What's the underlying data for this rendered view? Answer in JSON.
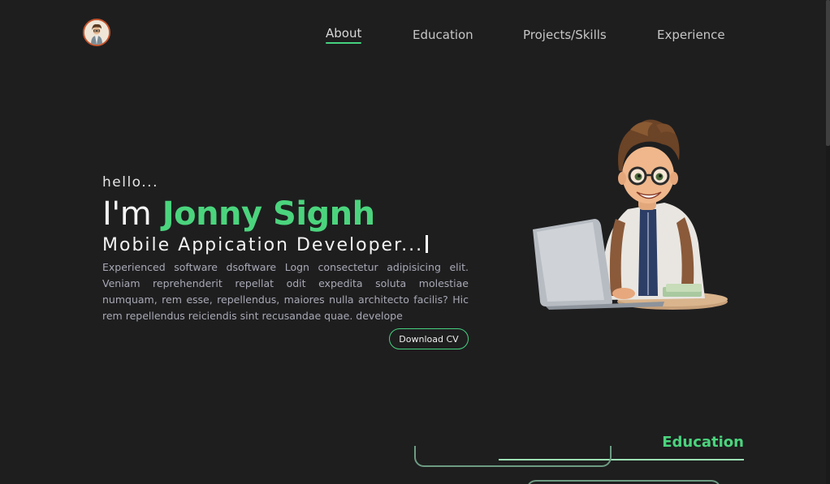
{
  "header": {
    "logo_icon": "avatar-logo-icon",
    "nav": [
      {
        "label": "About",
        "active": true
      },
      {
        "label": "Education",
        "active": false
      },
      {
        "label": "Projects/Skills",
        "active": false
      },
      {
        "label": "Experience",
        "active": false
      }
    ]
  },
  "hero": {
    "greeting": "hello...",
    "name_prefix": "I'm",
    "name": "Jonny Signh",
    "role": "Mobile Appication Developer...",
    "bio": "Experienced software dsoftware Logn consectetur adipisicing elit. Veniam reprehenderit repellat odit expedita soluta molestiae numquam, rem esse, repellendus, maiores nulla architecto facilis? Hic rem repellendus reiciendis sint recusandae quae. develope",
    "cta_label": "Download CV",
    "illustration_icon": "developer-with-laptop-icon"
  },
  "education": {
    "title": "Education"
  },
  "colors": {
    "background": "#1e1e1f",
    "accent": "#4bd47d",
    "text": "#e9e9e9",
    "muted": "#a8a9b5"
  }
}
